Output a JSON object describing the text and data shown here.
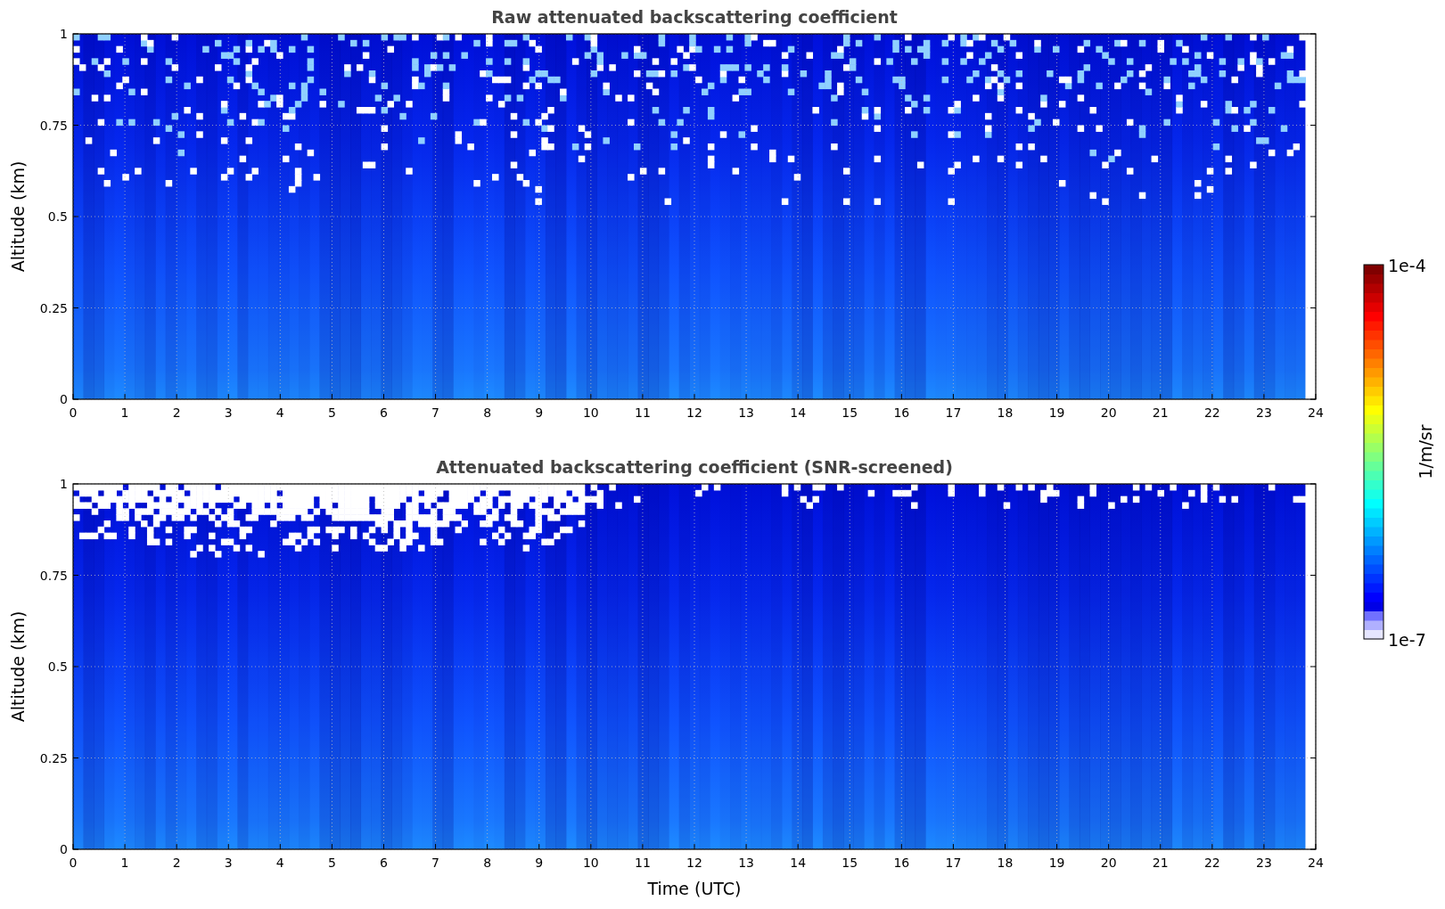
{
  "panels": [
    {
      "title": "Raw attenuated backscattering coefficient",
      "ylabel": "Altitude (km)",
      "yticks": [
        "1",
        "0.75",
        "0.5",
        "0.25",
        "0"
      ],
      "xticks": [
        "0",
        "1",
        "2",
        "3",
        "4",
        "5",
        "6",
        "7",
        "8",
        "9",
        "10",
        "11",
        "12",
        "13",
        "14",
        "15",
        "16",
        "17",
        "18",
        "19",
        "20",
        "21",
        "22",
        "23",
        "24"
      ],
      "screened": false
    },
    {
      "title": "Attenuated backscattering coefficient (SNR-screened)",
      "ylabel": "Altitude (km)",
      "yticks": [
        "1",
        "0.75",
        "0.5",
        "0.25",
        "0"
      ],
      "xticks": [
        "0",
        "1",
        "2",
        "3",
        "4",
        "5",
        "6",
        "7",
        "8",
        "9",
        "10",
        "11",
        "12",
        "13",
        "14",
        "15",
        "16",
        "17",
        "18",
        "19",
        "20",
        "21",
        "22",
        "23",
        "24"
      ],
      "screened": true,
      "xlabel": "Time (UTC)"
    }
  ],
  "colorbar": {
    "max_label": "1e-4",
    "min_label": "1e-7",
    "label": "1/m/sr"
  }
}
